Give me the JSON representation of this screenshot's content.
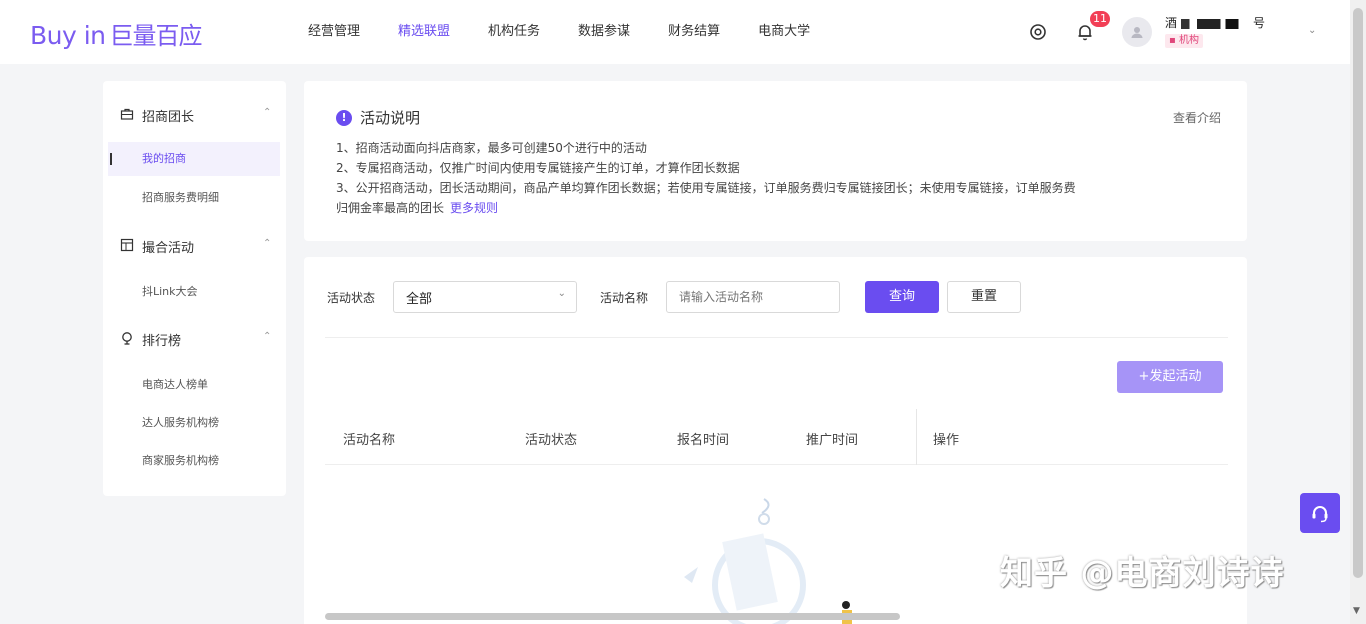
{
  "header": {
    "logo_text": "Buy in",
    "logo_cn": "巨量百应",
    "nav": [
      "经营管理",
      "精选联盟",
      "机构任务",
      "数据参谋",
      "财务结算",
      "电商大学"
    ],
    "active_nav_index": 1,
    "notification_count": "11",
    "account_name_prefix": "酒",
    "account_name_suffix": "号",
    "org_tag": "机构"
  },
  "sidebar": {
    "groups": [
      {
        "label": "招商团长",
        "icon": "briefcase-icon"
      },
      {
        "label": "撮合活动",
        "icon": "calendar-icon"
      },
      {
        "label": "排行榜",
        "icon": "trophy-icon"
      }
    ],
    "items": [
      "我的招商",
      "招商服务费明细",
      "抖Link大会",
      "电商达人榜单",
      "达人服务机构榜",
      "商家服务机构榜"
    ],
    "active_item_index": 0
  },
  "info": {
    "title": "活动说明",
    "view_intro": "查看介绍",
    "rules": [
      "1、招商活动面向抖店商家，最多可创建50个进行中的活动",
      "2、专属招商活动，仅推广时间内使用专属链接产生的订单，才算作团长数据",
      "3、公开招商活动，团长活动期间，商品产单均算作团长数据；若使用专属链接，订单服务费归专属链接团长；未使用专属链接，订单服务费",
      "归佣金率最高的团长"
    ],
    "more_link": "更多规则"
  },
  "filters": {
    "status_label": "活动状态",
    "status_value": "全部",
    "name_label": "活动名称",
    "name_placeholder": "请输入活动名称",
    "query_button": "查询",
    "reset_button": "重置"
  },
  "create_button": "+发起活动",
  "table": {
    "columns": [
      "活动名称",
      "活动状态",
      "报名时间",
      "推广时间",
      "操作"
    ]
  },
  "watermark": "知乎 @电商刘诗诗",
  "colors": {
    "accent": "#6a4df0",
    "accent_light": "#a694f7",
    "badge": "#f23f56"
  }
}
